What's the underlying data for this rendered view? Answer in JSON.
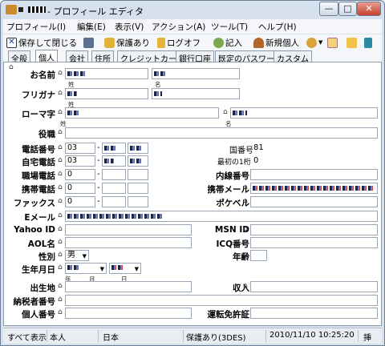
{
  "window": {
    "title": "- プロフィール エディタ",
    "min": "—",
    "max": "□",
    "close": "✕"
  },
  "menu": [
    "プロフィール(I)",
    "編集(E)",
    "表示(V)",
    "アクション(A)",
    "ツール(T)",
    "ヘルプ(H)"
  ],
  "toolbar": {
    "save_close": "保存して閉じる",
    "protect": "保護あり",
    "logoff": "ログオフ",
    "entry": "記入",
    "new_person": "新規個人"
  },
  "tabs": [
    "全般",
    "個人",
    "会社",
    "住所",
    "クレジットカード",
    "銀行口座",
    "既定のパスワード",
    "カスタム"
  ],
  "active_tab": "個人",
  "fields": {
    "name": "お名前",
    "furigana": "フリガナ",
    "romaji": "ローマ字",
    "title": "役職",
    "phone": "電話番号",
    "home_phone": "自宅電話",
    "work_phone": "職場電話",
    "mobile": "携帯電話",
    "fax": "ファックス",
    "email": "Eメール",
    "yahoo": "Yahoo ID",
    "aol": "AOL名",
    "gender": "性別",
    "birthday": "生年月日",
    "birthplace": "出生地",
    "taxpayer": "納税者番号",
    "personal_no": "個人番号",
    "msn": "MSN ID",
    "icq": "ICQ番号",
    "age": "年齢",
    "income": "収入",
    "license": "運転免許証",
    "extension": "内線番号",
    "mobile_mail": "携帯メール",
    "pager": "ポケベル"
  },
  "sub": {
    "last": "姓",
    "first": "名",
    "year": "年",
    "month": "月",
    "day": "日"
  },
  "values": {
    "phone_prefix": "03",
    "home_prefix": "03",
    "work_prefix": "0",
    "mobile_prefix": "0",
    "fax_prefix": "0",
    "gender": "男",
    "country_code_label": "国番号",
    "country_code": "81",
    "first_digit_label": "最初の1桁",
    "first_digit": "0"
  },
  "status": {
    "s1": "すべて表示",
    "s2": "本人",
    "s3": "日本",
    "s4": "保護あり(3DES)",
    "s5": "2010/11/10 10:25:20",
    "s6": "挿"
  }
}
